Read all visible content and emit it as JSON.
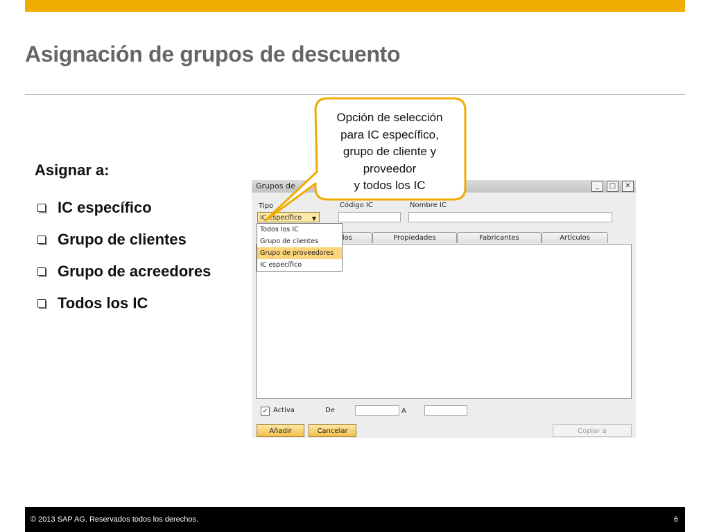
{
  "slide": {
    "title": "Asignación de grupos de descuento",
    "assign_heading": "Asignar a:",
    "bullets": [
      "IC específico",
      "Grupo de clientes",
      "Grupo de acreedores",
      "Todos los IC"
    ]
  },
  "callout": {
    "lines": [
      "Opción de selección",
      "para IC específico,",
      "grupo de cliente y",
      "proveedor",
      "y todos los IC"
    ]
  },
  "window": {
    "title": "Grupos de",
    "controls": {
      "minimize": "_",
      "maximize": "□",
      "close": "✕"
    },
    "tipo_label": "Tipo",
    "tipo_value": "IC específico",
    "codigo_label": "Código IC",
    "nombre_label": "Nombre IC",
    "dropdown_options": [
      "Todos los IC",
      "Grupo de clientes",
      "Grupo de proveedores",
      "IC específico"
    ],
    "highlighted_option": "Grupo de proveedores",
    "tabs": [
      "ulos",
      "Propiedades",
      "Fabricantes",
      "Artículos"
    ],
    "activa_label": "Activa",
    "activa_checked": true,
    "de_label": "De",
    "a_label": "A",
    "buttons": {
      "add": "Añadir",
      "cancel": "Cancelar",
      "copy_to": "Copiar a"
    }
  },
  "footer": {
    "copyright": "©  2013 SAP AG. Reservados todos los derechos.",
    "page_number": "6"
  },
  "colors": {
    "accent": "#f0ab00",
    "title": "#666666",
    "footer_bg": "#000000"
  }
}
